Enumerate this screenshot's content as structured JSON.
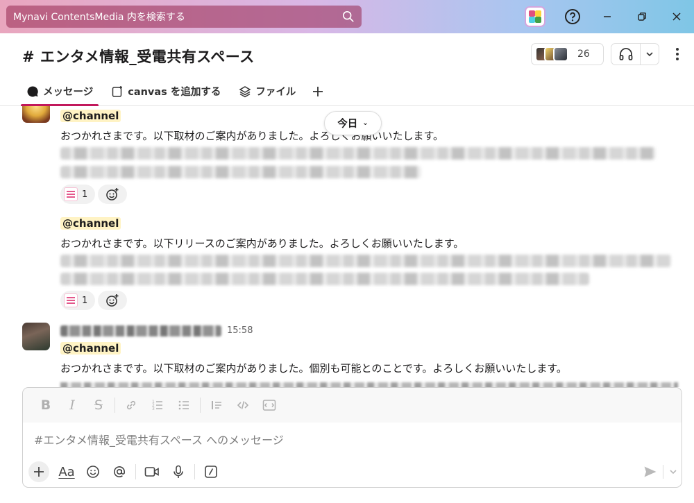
{
  "search": {
    "placeholder": "Mynavi ContentsMedia 内を検索する"
  },
  "channel": {
    "title": "# エンタメ情報_受電共有スペース",
    "member_count": "26"
  },
  "tabs": [
    {
      "label": "メッセージ",
      "active": true
    },
    {
      "label": "canvas を追加する",
      "active": false
    },
    {
      "label": "ファイル",
      "active": false
    }
  ],
  "date_divider": {
    "label": "今日"
  },
  "messages": [
    {
      "mention": "@channel",
      "text": "おつかれさまです。以下取材のご案内がありました。よろしくお願いいたします。",
      "reaction_count": "1"
    },
    {
      "mention": "@channel",
      "text": "おつかれさまです。以下リリースのご案内がありました。よろしくお願いいたします。",
      "reaction_count": "1"
    },
    {
      "time": "15:58",
      "mention": "@channel",
      "text": "おつかれさまです。以下取材のご案内がありました。個別も可能とのことです。よろしくお願いいたします。"
    }
  ],
  "composer": {
    "placeholder": "#エンタメ情報_受電共有スペース へのメッセージ"
  },
  "colors": {
    "active_tab": "#c2185b",
    "mention_bg": "#fff3c4"
  }
}
